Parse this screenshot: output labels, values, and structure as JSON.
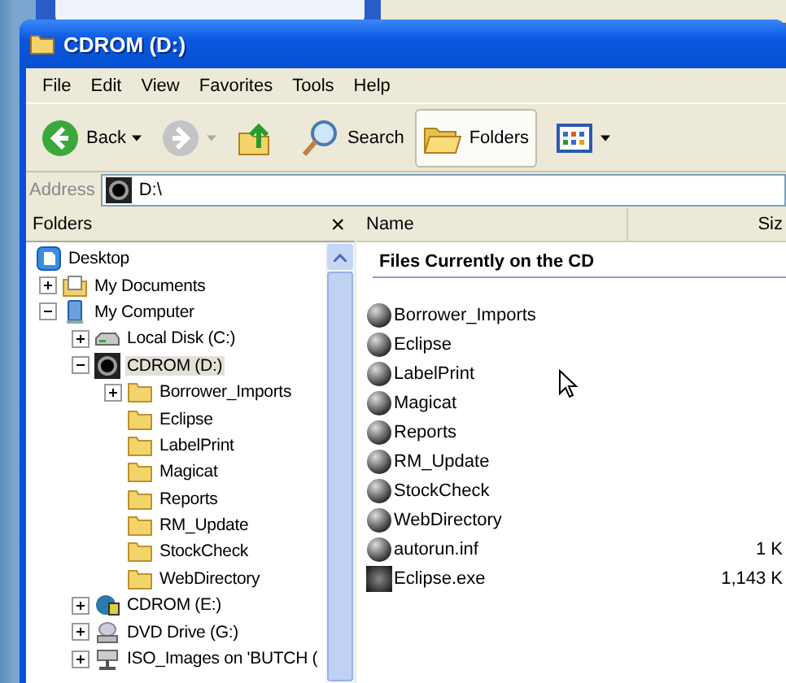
{
  "window": {
    "title": "CDROM (D:)"
  },
  "menu": [
    "File",
    "Edit",
    "View",
    "Favorites",
    "Tools",
    "Help"
  ],
  "toolbar": [
    {
      "kind": "back",
      "label": "Back",
      "disabled": false,
      "selected": false
    },
    {
      "kind": "forward",
      "disabled": true,
      "selected": false
    },
    {
      "kind": "up",
      "selected": false
    },
    {
      "kind": "search",
      "label": "Search",
      "disabled": false,
      "selected": false
    },
    {
      "kind": "folders",
      "label": "Folders",
      "disabled": false,
      "selected": true
    },
    {
      "kind": "views",
      "selected": false
    }
  ],
  "address": {
    "label": "Address",
    "value": "D:\\"
  },
  "folders_pane": {
    "title": "Folders",
    "close": "×",
    "tree": [
      {
        "label": "Desktop",
        "kind": "desktop",
        "selected": false,
        "children": [
          {
            "label": "My Documents",
            "kind": "documents",
            "expanded": false,
            "selected": false
          },
          {
            "label": "My Computer",
            "kind": "computer",
            "expanded": true,
            "selected": false,
            "children": [
              {
                "label": "Local Disk (C:)",
                "kind": "disk",
                "expanded": false,
                "selected": false
              },
              {
                "label": "CDROM (D:)",
                "kind": "cdrom",
                "expanded": true,
                "selected": true,
                "children": [
                  {
                    "label": "Borrower_Imports",
                    "kind": "folder",
                    "expanded": false,
                    "selected": false
                  },
                  {
                    "label": "Eclipse",
                    "kind": "folder",
                    "selected": false
                  },
                  {
                    "label": "LabelPrint",
                    "kind": "folder",
                    "selected": false
                  },
                  {
                    "label": "Magicat",
                    "kind": "folder",
                    "selected": false
                  },
                  {
                    "label": "Reports",
                    "kind": "folder",
                    "selected": false
                  },
                  {
                    "label": "RM_Update",
                    "kind": "folder",
                    "selected": false
                  },
                  {
                    "label": "StockCheck",
                    "kind": "folder",
                    "selected": false
                  },
                  {
                    "label": "WebDirectory",
                    "kind": "folder",
                    "selected": false
                  }
                ]
              },
              {
                "label": "CDROM (E:)",
                "kind": "cdrom-app",
                "expanded": false,
                "selected": false
              },
              {
                "label": "DVD Drive (G:)",
                "kind": "dvd",
                "expanded": false,
                "selected": false
              },
              {
                "label": "ISO_Images on 'BUTCH (",
                "kind": "network",
                "expanded": false,
                "selected": false
              }
            ]
          }
        ]
      }
    ]
  },
  "file_list": {
    "columns": [
      "Name",
      "Siz"
    ],
    "group": "Files Currently on the CD",
    "rows": [
      {
        "name": "Borrower_Imports",
        "kind": "sphere"
      },
      {
        "name": "Eclipse",
        "kind": "sphere"
      },
      {
        "name": "LabelPrint",
        "kind": "sphere"
      },
      {
        "name": "Magicat",
        "kind": "sphere"
      },
      {
        "name": "Reports",
        "kind": "sphere"
      },
      {
        "name": "RM_Update",
        "kind": "sphere"
      },
      {
        "name": "StockCheck",
        "kind": "sphere"
      },
      {
        "name": "WebDirectory",
        "kind": "sphere"
      },
      {
        "name": "autorun.inf",
        "kind": "sphere",
        "size": "1 K"
      },
      {
        "name": "Eclipse.exe",
        "kind": "square",
        "size": "1,143 K"
      }
    ]
  }
}
